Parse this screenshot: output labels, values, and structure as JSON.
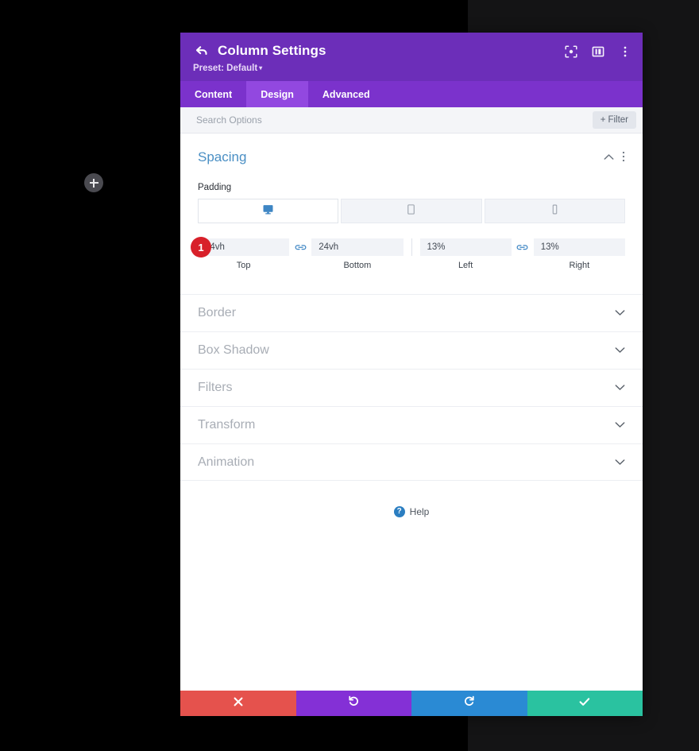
{
  "canvas": {
    "add_button_name": "add-section-button"
  },
  "modal": {
    "header": {
      "back_icon": "back-arrow-icon",
      "title": "Column Settings",
      "preset_label": "Preset: Default",
      "preset_caret": "▾",
      "icons": [
        {
          "name": "focus-icon",
          "label": "Focus"
        },
        {
          "name": "layout-panel-icon",
          "label": "Layout"
        },
        {
          "name": "more-vertical-icon",
          "label": "More"
        }
      ]
    },
    "tabs": [
      {
        "label": "Content",
        "active": false
      },
      {
        "label": "Design",
        "active": true
      },
      {
        "label": "Advanced",
        "active": false
      }
    ],
    "search": {
      "placeholder": "Search Options",
      "value": "",
      "filter_label": "Filter",
      "filter_plus": "+"
    },
    "spacing_section": {
      "title": "Spacing",
      "collapse_caret": "⌃",
      "kebab": "⋮",
      "padding_label": "Padding",
      "devices": [
        {
          "name": "device-desktop",
          "icon": "desktop-icon",
          "active": true
        },
        {
          "name": "device-tablet",
          "icon": "tablet-icon",
          "active": false
        },
        {
          "name": "device-phone",
          "icon": "phone-icon",
          "active": false
        }
      ],
      "step_badge": "1",
      "fields": [
        {
          "name": "padding-top",
          "value": "24vh",
          "sublabel": "Top"
        },
        {
          "name": "padding-bottom",
          "value": "24vh",
          "sublabel": "Bottom"
        },
        {
          "name": "padding-left",
          "value": "13%",
          "sublabel": "Left"
        },
        {
          "name": "padding-right",
          "value": "13%",
          "sublabel": "Right"
        }
      ]
    },
    "collapsed_sections": [
      {
        "label": "Border"
      },
      {
        "label": "Box Shadow"
      },
      {
        "label": "Filters"
      },
      {
        "label": "Transform"
      },
      {
        "label": "Animation"
      }
    ],
    "help": {
      "label": "Help",
      "icon_glyph": "?"
    },
    "footer": [
      {
        "name": "cancel-button",
        "icon": "close-icon",
        "color": "#e5524d"
      },
      {
        "name": "undo-button",
        "icon": "undo-icon",
        "color": "#8430d6"
      },
      {
        "name": "redo-button",
        "icon": "redo-icon",
        "color": "#2a8ad4"
      },
      {
        "name": "save-button",
        "icon": "check-icon",
        "color": "#2ac2a0"
      }
    ]
  },
  "colors": {
    "header_purple": "#6c2eb9",
    "tabs_purple": "#7b32cc",
    "tab_active_purple": "#9248e0",
    "accent_blue": "#4a8fc4",
    "badge_red": "#d8202a",
    "backdrop_black": "#000000",
    "backdrop_charcoal": "#141415"
  }
}
